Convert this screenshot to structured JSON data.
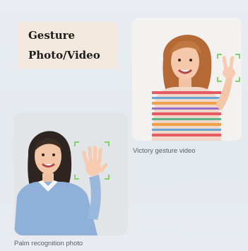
{
  "title": {
    "line1": "Gesture",
    "line2": "Photo/Video"
  },
  "captions": {
    "victory": "Victory gesture video",
    "palm": "Palm recognition photo"
  },
  "icons": {
    "detection_frame": "corner-bracket-frame-icon"
  },
  "colors": {
    "background": "#e6eaef",
    "title_box": "#f3e9de",
    "detection_frame": "#7fd36a",
    "caption_text": "#5b5f63"
  }
}
